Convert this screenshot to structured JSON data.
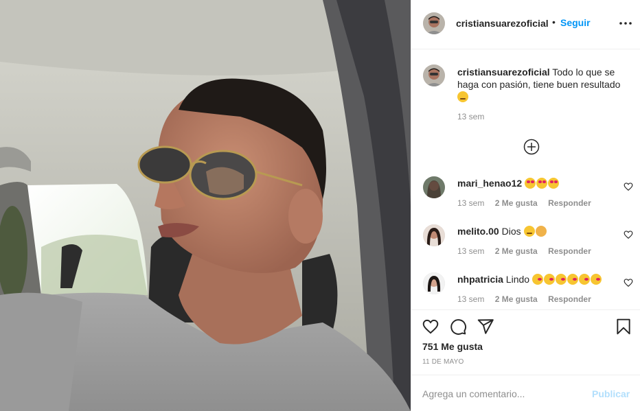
{
  "post": {
    "username": "cristiansuarezoficial",
    "follow_separator": "•",
    "follow_label": "Seguir",
    "more_icon": "more-horizontal-icon",
    "caption": {
      "username": "cristiansuarezoficial",
      "text": "Todo lo que se haga con pasión, tiene buen resultado",
      "emoji": "relieved-face",
      "time": "13 sem"
    },
    "load_more_icon": "plus-circle-icon",
    "comments": [
      {
        "username": "mari_henao12",
        "text": "",
        "emojis": [
          "heart-eyes",
          "heart-eyes",
          "heart-eyes"
        ],
        "time": "13 sem",
        "likes": "2 Me gusta",
        "reply": "Responder"
      },
      {
        "username": "melito.00",
        "text": "Dios",
        "emojis": [
          "smirk",
          "woman-gesturing"
        ],
        "time": "13 sem",
        "likes": "2 Me gusta",
        "reply": "Responder"
      },
      {
        "username": "nhpatricia",
        "text": "Lindo",
        "emojis": [
          "kiss",
          "kiss",
          "kiss",
          "kiss",
          "kiss",
          "kiss"
        ],
        "time": "13 sem",
        "likes": "2 Me gusta",
        "reply": "Responder"
      }
    ],
    "likes_count": "751 Me gusta",
    "date": "11 DE MAYO",
    "comment_placeholder": "Agrega un comentario...",
    "publish_label": "Publicar"
  },
  "colors": {
    "link_blue": "#0095f6",
    "publish_disabled": "#b2dffc",
    "muted_text": "#8e8e8e",
    "border": "#efefef"
  }
}
